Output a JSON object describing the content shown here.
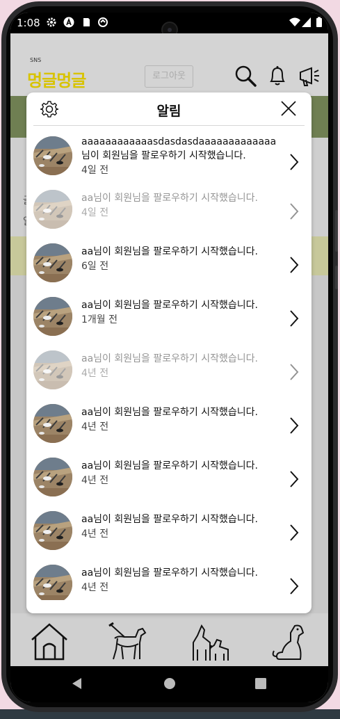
{
  "status_bar": {
    "time": "1:08",
    "icons": [
      "settings-icon",
      "app-a-icon",
      "sd-card-icon",
      "sync-icon",
      "wifi-icon",
      "signal-icon",
      "battery-icon"
    ]
  },
  "app_header": {
    "logo_small": "SNS",
    "logo": "멍글멍글",
    "logout_label": "로그아웃",
    "icons": [
      "search-icon",
      "bell-icon",
      "megaphone-icon"
    ]
  },
  "background": {
    "letters": [
      "글",
      "알"
    ]
  },
  "notification_modal": {
    "title": "알림",
    "items": [
      {
        "message": "aaaaaaaaaaaasdasdasdaaaaaaaaaaaaa님이 회원님을 팔로우하기 시작했습니다.",
        "time_ago": "4일 전",
        "read": false
      },
      {
        "message": "aa님이 회원님을 팔로우하기 시작했습니다.",
        "time_ago": "4일 전",
        "read": true
      },
      {
        "message": "aa님이 회원님을 팔로우하기 시작했습니다.",
        "time_ago": "6일 전",
        "read": false
      },
      {
        "message": "aa님이 회원님을 팔로우하기 시작했습니다.",
        "time_ago": "1개월 전",
        "read": false
      },
      {
        "message": "aa님이 회원님을 팔로우하기 시작했습니다.",
        "time_ago": "4년 전",
        "read": true
      },
      {
        "message": "aa님이 회원님을 팔로우하기 시작했습니다.",
        "time_ago": "4년 전",
        "read": false
      },
      {
        "message": "aa님이 회원님을 팔로우하기 시작했습니다.",
        "time_ago": "4년 전",
        "read": false
      },
      {
        "message": "aa님이 회원님을 팔로우하기 시작했습니다.",
        "time_ago": "4년 전",
        "read": false
      },
      {
        "message": "aa님이 회원님을 팔로우하기 시작했습니다.",
        "time_ago": "4년 전",
        "read": false
      }
    ]
  },
  "bottom_nav": {
    "items": [
      "home-icon",
      "dog-walk-icon",
      "dog-family-icon",
      "dog-sitting-icon"
    ]
  },
  "system_nav": {
    "buttons": [
      "back-icon",
      "home-circle-icon",
      "recents-icon"
    ]
  },
  "colors": {
    "logo": "#d8c300",
    "modal_bg": "#ffffff",
    "dim_overlay": "#d1d1d1"
  }
}
